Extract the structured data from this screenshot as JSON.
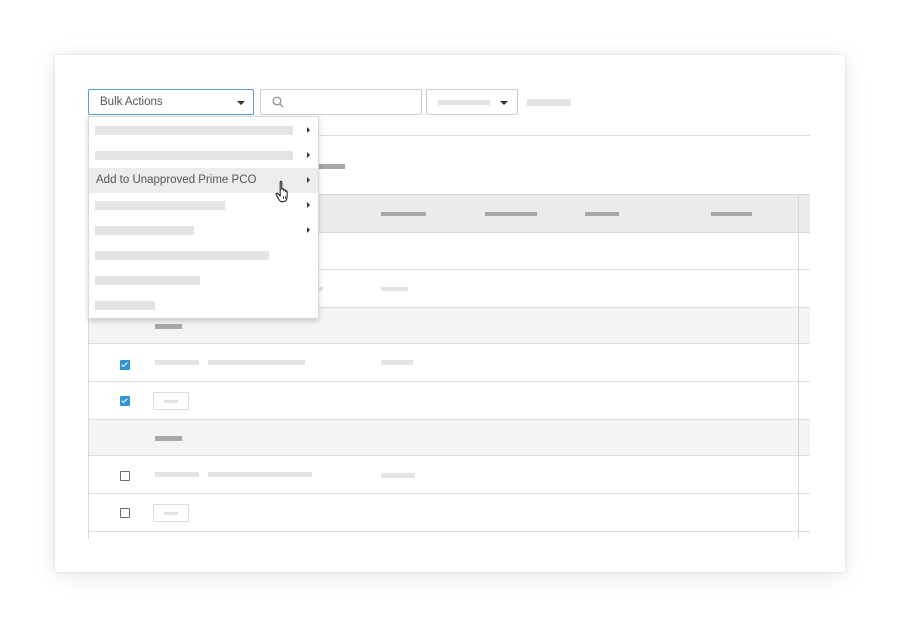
{
  "toolbar": {
    "bulk_actions_label": "Bulk Actions",
    "bulk_actions_icon": "chevron-down-icon",
    "search_icon": "search-icon",
    "search_value": "",
    "filter_icon": "chevron-down-icon"
  },
  "bulk_menu": {
    "items": [
      {
        "label": "",
        "has_submenu": true
      },
      {
        "label": "",
        "has_submenu": true
      },
      {
        "label": "Add to Unapproved Prime PCO",
        "has_submenu": true,
        "hovered": true
      },
      {
        "label": "",
        "has_submenu": true
      },
      {
        "label": "",
        "has_submenu": true
      },
      {
        "label": "",
        "has_submenu": false
      },
      {
        "label": "",
        "has_submenu": false
      },
      {
        "label": "",
        "has_submenu": false
      }
    ]
  },
  "table": {
    "rows": [
      {
        "type": "item"
      },
      {
        "type": "item"
      },
      {
        "type": "group"
      },
      {
        "type": "item",
        "checked": true
      },
      {
        "type": "item",
        "checked": true
      },
      {
        "type": "group"
      },
      {
        "type": "item",
        "checked": false
      },
      {
        "type": "item",
        "checked": false
      }
    ]
  },
  "colors": {
    "accent": "#2e94d6",
    "focus_border": "#5b9bd5",
    "header_bg": "#ebebeb",
    "group_bg": "#f4f4f4"
  },
  "cursor_icon": "pointer-hand-icon"
}
